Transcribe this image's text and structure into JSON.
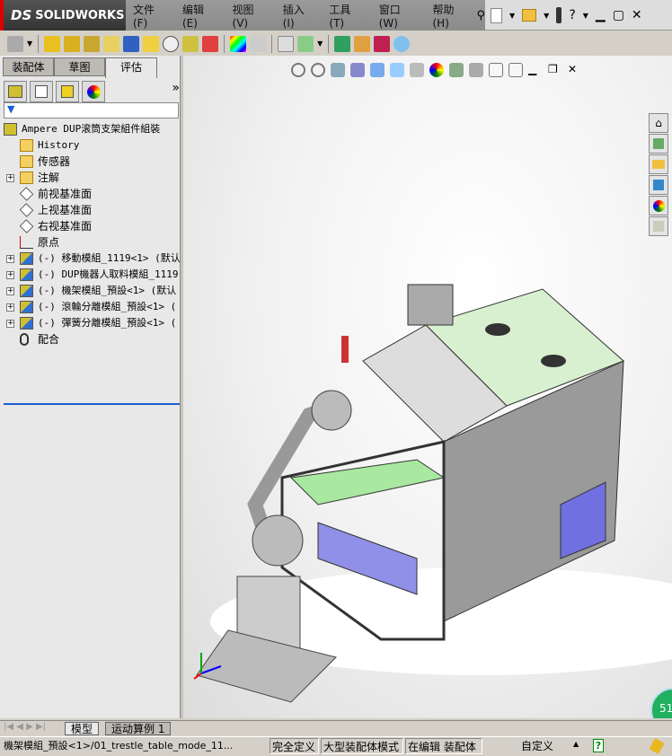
{
  "app": {
    "logo": "SOLIDWORKS",
    "menu": [
      "文件(F)",
      "编辑(E)",
      "视图(V)",
      "插入(I)",
      "工具(T)",
      "窗口(W)",
      "帮助(H)"
    ]
  },
  "feature_manager": {
    "tabs": [
      "装配体",
      "草图",
      "评估"
    ],
    "active_tab": "评估",
    "more": "»",
    "tree": [
      {
        "label": "Ampere DUP滚筒支架組件組裝",
        "icon": "assembly-icon",
        "level": 0,
        "expand": false
      },
      {
        "label": "History",
        "icon": "history-folder-icon",
        "level": 1,
        "expand": false
      },
      {
        "label": "传感器",
        "icon": "sensor-folder-icon",
        "level": 1,
        "expand": false
      },
      {
        "label": "注解",
        "icon": "annotation-folder-icon",
        "level": 1,
        "expand": true
      },
      {
        "label": "前视基准面",
        "icon": "plane-icon",
        "level": 1,
        "expand": false
      },
      {
        "label": "上视基准面",
        "icon": "plane-icon",
        "level": 1,
        "expand": false
      },
      {
        "label": "右视基准面",
        "icon": "plane-icon",
        "level": 1,
        "expand": false
      },
      {
        "label": "原点",
        "icon": "origin-icon",
        "level": 1,
        "expand": false
      },
      {
        "label": "(-) 移動模組_1119<1> (默认",
        "icon": "subassembly-icon",
        "level": 1,
        "expand": true
      },
      {
        "label": "(-) DUP機器人取料模組_1119",
        "icon": "subassembly-icon",
        "level": 1,
        "expand": true
      },
      {
        "label": "(-) 機架模組_預設<1> (默认",
        "icon": "subassembly-icon",
        "level": 1,
        "expand": true
      },
      {
        "label": "(-) 滾輪分離模組_預設<1> (",
        "icon": "subassembly-icon",
        "level": 1,
        "expand": true
      },
      {
        "label": "(-) 彈簧分離模組_預設<1> (",
        "icon": "subassembly-icon",
        "level": 1,
        "expand": true
      },
      {
        "label": "配合",
        "icon": "mates-icon",
        "level": 1,
        "expand": false
      }
    ]
  },
  "bottom_tabs": [
    "模型",
    "运动算例 1"
  ],
  "status": {
    "path": "機架模組_預設<1>/01_trestle_table_mode_11...",
    "state": "完全定义",
    "mode": "大型装配体模式",
    "editing": "在编辑 装配体",
    "units": "自定义",
    "help": "?",
    "badge": "51"
  },
  "colors": {
    "accent": "#1a5fd6",
    "frame": "#a8e8a0",
    "panel": "#8080e0"
  }
}
